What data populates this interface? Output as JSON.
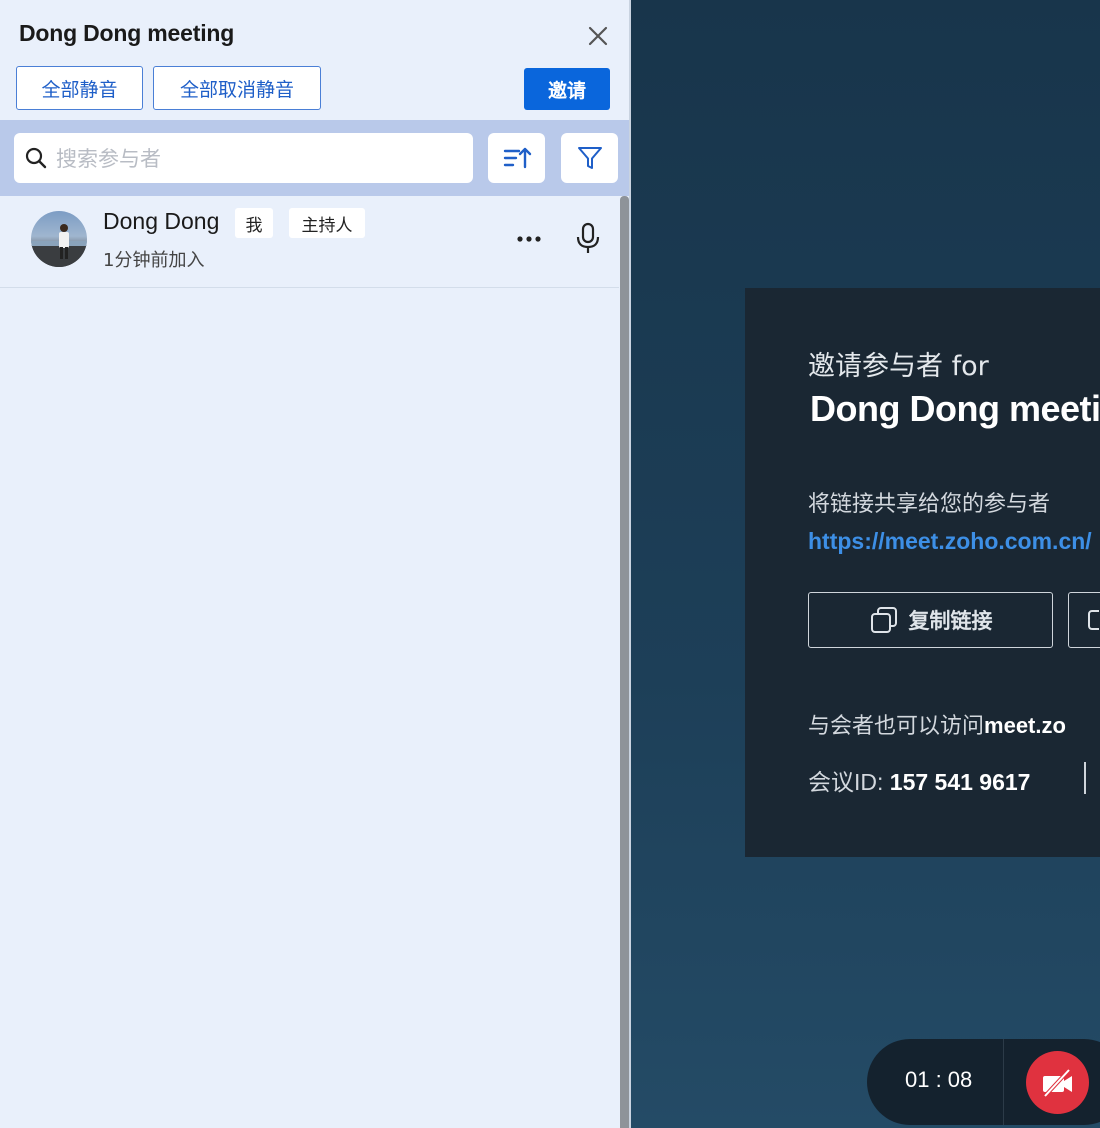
{
  "panel": {
    "title": "Dong Dong meeting",
    "mute_all_label": "全部静音",
    "unmute_all_label": "全部取消静音",
    "invite_label": "邀请",
    "search_placeholder": "搜索参与者",
    "icons": {
      "close": "close-icon",
      "search": "search-icon",
      "sort": "sort-icon",
      "filter": "filter-icon"
    }
  },
  "participants": [
    {
      "name": "Dong Dong",
      "tag_me": "我",
      "tag_host": "主持人",
      "joined": "1分钟前加入",
      "icons": {
        "more": "more-options-icon",
        "mic": "microphone-icon"
      }
    }
  ],
  "invite_card": {
    "invite_for": "邀请参与者 for",
    "meeting_title": "Dong Dong meeti",
    "share_label": "将链接共享给您的参与者",
    "link": "https://meet.zoho.com.cn/",
    "copy_link_label": "复制链接",
    "visit_prefix": "与会者也可以访问",
    "visit_domain": "meet.zo",
    "meeting_id_label": "会议ID: ",
    "meeting_id": "157 541 9617"
  },
  "controls": {
    "timer": "01 : 08",
    "video_off_icon": "video-off-icon",
    "video_off_color": "#e0323f"
  }
}
